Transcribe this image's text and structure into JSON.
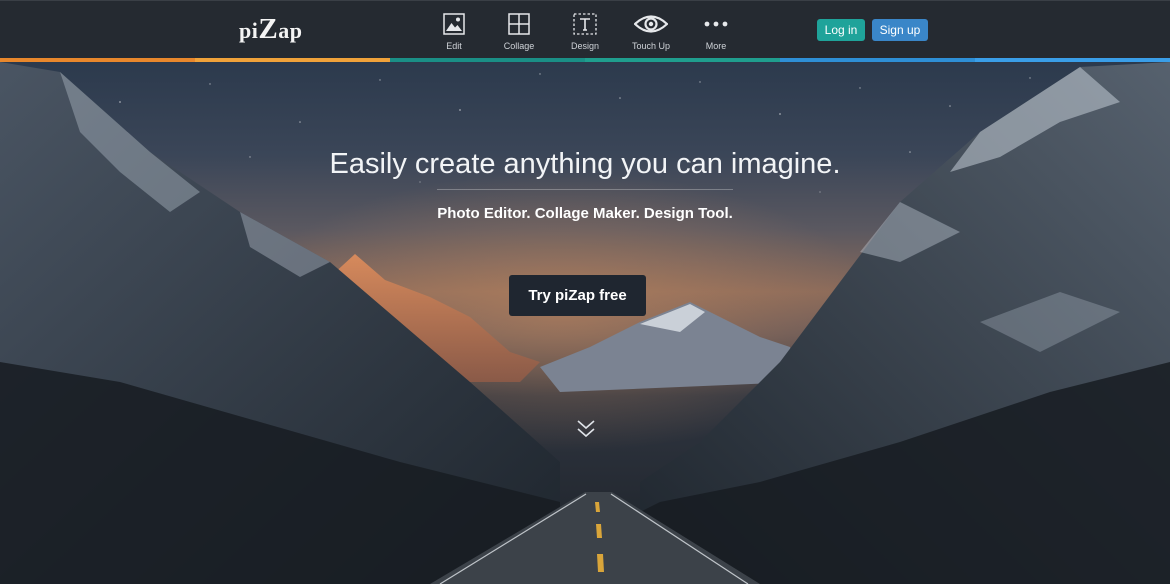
{
  "header": {
    "logo_prefix": "pi",
    "logo_big": "Z",
    "logo_suffix": "ap",
    "nav": [
      {
        "label": "Edit",
        "icon": "image-icon"
      },
      {
        "label": "Collage",
        "icon": "collage-grid-icon"
      },
      {
        "label": "Design",
        "icon": "text-frame-icon"
      },
      {
        "label": "Touch Up",
        "icon": "eye-icon"
      },
      {
        "label": "More",
        "icon": "more-dots-icon"
      }
    ],
    "login_label": "Log in",
    "signup_label": "Sign up"
  },
  "hero": {
    "headline": "Easily create anything you can imagine.",
    "subline": "Photo Editor. Collage Maker. Design Tool.",
    "cta_label": "Try piZap free",
    "scroll_icon": "double-chevron-down-icon"
  },
  "colors": {
    "topbar": "#252a31",
    "login_button": "#1fa39a",
    "signup_button": "#3a86c8",
    "cta_button": "#1f2630",
    "stripe": [
      "#e8872c",
      "#f0a23a",
      "#1a8f86",
      "#1f9e8e",
      "#2e8fd6",
      "#3a9ee8"
    ]
  }
}
